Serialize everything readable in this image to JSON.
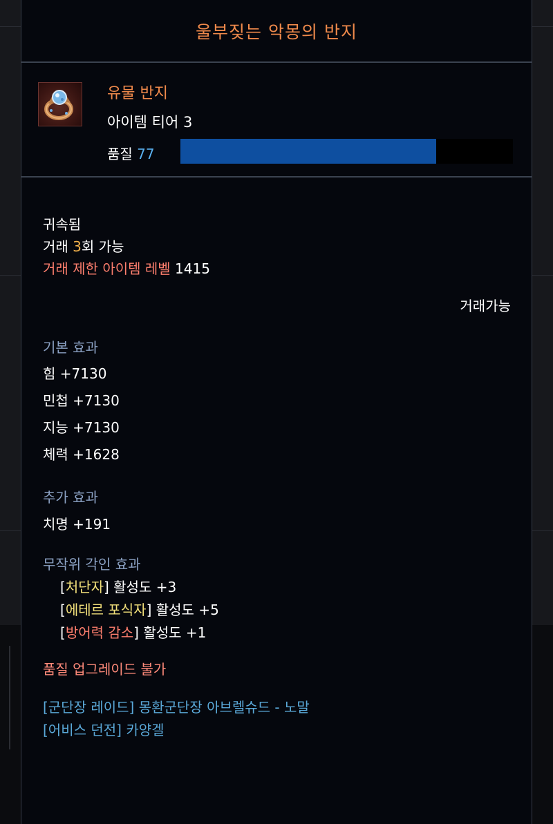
{
  "item": {
    "name": "울부짖는 악몽의 반지",
    "grade_type": "유물 반지",
    "tier": "아이템 티어 3",
    "quality_label": "품질",
    "quality_value": "77",
    "quality_fraction": 0.77,
    "icon": "ring-icon"
  },
  "trade": {
    "bound": "귀속됨",
    "trade_prefix": "거래 ",
    "trade_count": "3",
    "trade_suffix": "회 가능",
    "restrict_label": "거래 제한 아이템 레벨",
    "restrict_level": "1415",
    "tradable": "거래가능"
  },
  "base_effects": {
    "title": "기본 효과",
    "lines": [
      "힘 +7130",
      "민첩 +7130",
      "지능 +7130",
      "체력 +1628"
    ]
  },
  "extra_effects": {
    "title": "추가 효과",
    "lines": [
      "치명 +191"
    ]
  },
  "engravings": {
    "title": "무작위 각인 효과",
    "items": [
      {
        "open": "[",
        "name": "처단자",
        "close": "]",
        "value": " 활성도 +3"
      },
      {
        "open": "[",
        "name": "에테르 포식자",
        "close": "]",
        "value": " 활성도 +5"
      },
      {
        "open": "[",
        "name": "방어력 감소",
        "close": "]",
        "value": " 활성도 +1"
      }
    ]
  },
  "upgrade_note": "품질 업그레이드 불가",
  "sources": [
    "[군단장 레이드] 몽환군단장 아브렐슈드 - 노말",
    "[어비스 던전] 카양겔"
  ],
  "colors": {
    "title": "#f08a4b",
    "quality_bar": "#0e4fa0",
    "quality_value": "#5ab1f0",
    "warning": "#ff7f6e",
    "section": "#8ca2c4",
    "engrave_name": "#f2e07a",
    "source": "#5aa8d8"
  }
}
